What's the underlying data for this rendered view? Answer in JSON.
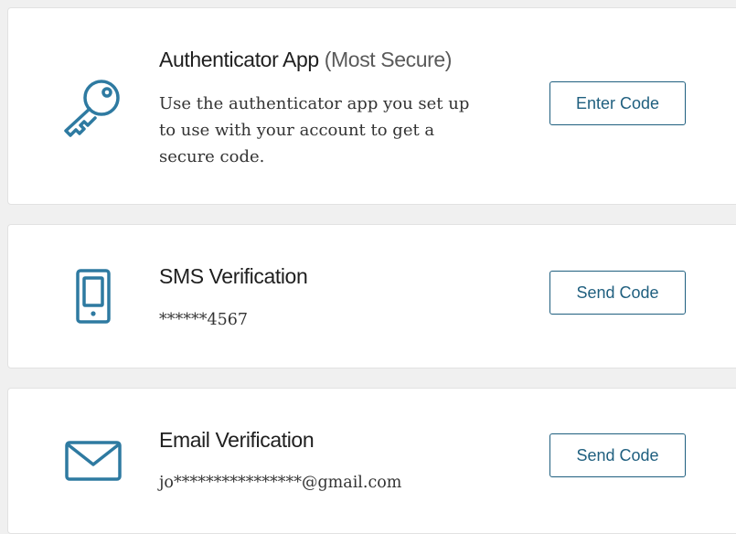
{
  "accent_color": "#2e7aa1",
  "methods": [
    {
      "icon": "key-icon",
      "title": "Authenticator App",
      "title_note": "(Most Secure)",
      "description": "Use the authenticator app you set up\nto use with your account to get a\nsecure code.",
      "button_label": "Enter Code"
    },
    {
      "icon": "phone-icon",
      "title": "SMS Verification",
      "detail": "******4567",
      "button_label": "Send Code"
    },
    {
      "icon": "envelope-icon",
      "title": "Email Verification",
      "detail": "jo****************@gmail.com",
      "button_label": "Send Code"
    }
  ]
}
